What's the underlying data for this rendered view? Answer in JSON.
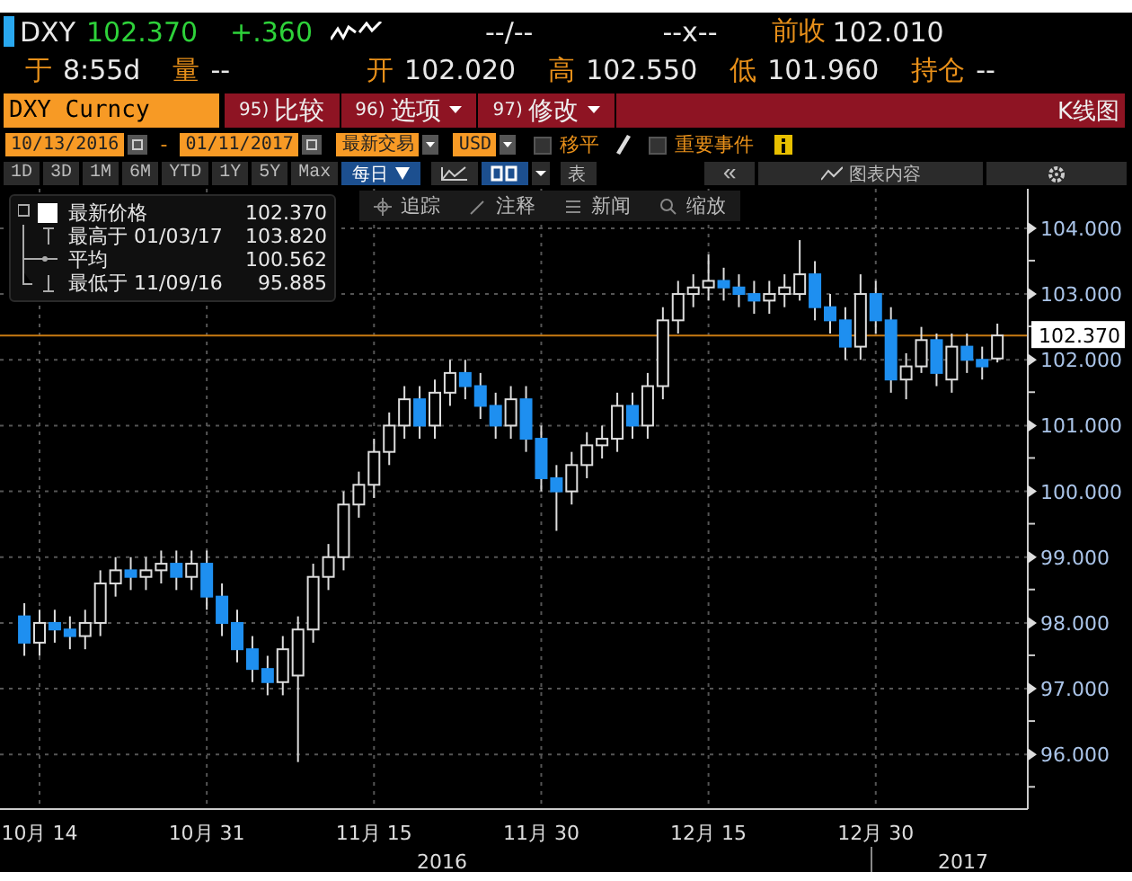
{
  "quote": {
    "ticker": "DXY",
    "price": "102.370",
    "change": "+.360",
    "bid_ask": "--/--",
    "size": "--x--",
    "prev_close_label": "前收",
    "prev_close": "102.010"
  },
  "stats": [
    {
      "label": "于",
      "value": "8:55d"
    },
    {
      "label": "量",
      "value": "--"
    },
    {
      "label": "开",
      "value": "102.020"
    },
    {
      "label": "高",
      "value": "102.550"
    },
    {
      "label": "低",
      "value": "101.960"
    },
    {
      "label": "持仓",
      "value": "--"
    }
  ],
  "security": "DXY Curncy",
  "actions": [
    {
      "number": "95)",
      "label": "比较",
      "dropdown": false
    },
    {
      "number": "96)",
      "label": "选项",
      "dropdown": true
    },
    {
      "number": "97)",
      "label": "修改",
      "dropdown": true
    }
  ],
  "view_title": "K线图",
  "date_range": {
    "start": "10/13/2016",
    "separator": "-",
    "end": "01/11/2017"
  },
  "price_field": "最新交易",
  "currency": "USD",
  "options": [
    {
      "label": "移平",
      "checked": false
    },
    {
      "label": "重要事件",
      "checked": false
    }
  ],
  "periods": [
    {
      "label": "1D",
      "selected": false
    },
    {
      "label": "3D",
      "selected": false
    },
    {
      "label": "1M",
      "selected": false
    },
    {
      "label": "6M",
      "selected": false
    },
    {
      "label": "YTD",
      "selected": false
    },
    {
      "label": "1Y",
      "selected": false
    },
    {
      "label": "5Y",
      "selected": false
    },
    {
      "label": "Max",
      "selected": false
    }
  ],
  "frequency": "每日",
  "table_button": "表",
  "collapse_button": "«",
  "chart_contents": "图表内容",
  "tools": [
    "追踪",
    "注释",
    "新闻",
    "缩放"
  ],
  "legend": [
    {
      "kind": "last",
      "label": "最新价格",
      "value": "102.370"
    },
    {
      "kind": "high",
      "label": "最高于 01/03/17",
      "value": "103.820"
    },
    {
      "kind": "average",
      "label": "平均",
      "value": "100.562"
    },
    {
      "kind": "low",
      "label": "最低于 11/09/16",
      "value": "95.885"
    }
  ],
  "chart": {
    "price_tag": "102.370",
    "years": [
      "2016",
      "2017"
    ],
    "chart_data": {
      "type": "candlestick",
      "categories": [
        null,
        "10月 14",
        null,
        null,
        null,
        null,
        null,
        null,
        null,
        null,
        null,
        null,
        "10月 31",
        null,
        null,
        null,
        null,
        null,
        null,
        null,
        null,
        null,
        null,
        "11月 15",
        null,
        null,
        null,
        null,
        null,
        null,
        null,
        null,
        null,
        null,
        "11月 30",
        null,
        null,
        null,
        null,
        null,
        null,
        null,
        null,
        null,
        null,
        "12月 15",
        null,
        null,
        null,
        null,
        null,
        null,
        null,
        null,
        null,
        null,
        "12月 30",
        null,
        null,
        null,
        null,
        null,
        null,
        null,
        null
      ],
      "ohlc": [
        [
          98.1,
          98.3,
          97.5,
          97.7
        ],
        [
          97.7,
          98.2,
          97.5,
          98.0
        ],
        [
          98.0,
          98.2,
          97.7,
          97.9
        ],
        [
          97.9,
          98.1,
          97.6,
          97.8
        ],
        [
          97.8,
          98.2,
          97.6,
          98.0
        ],
        [
          98.0,
          98.8,
          97.8,
          98.6
        ],
        [
          98.6,
          99.0,
          98.4,
          98.8
        ],
        [
          98.8,
          99.0,
          98.5,
          98.7
        ],
        [
          98.7,
          99.0,
          98.5,
          98.8
        ],
        [
          98.8,
          99.1,
          98.6,
          98.9
        ],
        [
          98.9,
          99.1,
          98.5,
          98.7
        ],
        [
          98.7,
          99.1,
          98.5,
          98.9
        ],
        [
          98.9,
          99.1,
          98.2,
          98.4
        ],
        [
          98.4,
          98.6,
          97.8,
          98.0
        ],
        [
          98.0,
          98.2,
          97.4,
          97.6
        ],
        [
          97.6,
          97.8,
          97.1,
          97.3
        ],
        [
          97.3,
          97.5,
          96.9,
          97.1
        ],
        [
          97.1,
          97.8,
          96.9,
          97.6
        ],
        [
          97.2,
          98.1,
          95.885,
          97.9
        ],
        [
          97.9,
          98.9,
          97.7,
          98.7
        ],
        [
          98.7,
          99.2,
          98.5,
          99.0
        ],
        [
          99.0,
          100.0,
          98.8,
          99.8
        ],
        [
          99.8,
          100.3,
          99.6,
          100.1
        ],
        [
          100.1,
          100.8,
          99.9,
          100.6
        ],
        [
          100.6,
          101.2,
          100.4,
          101.0
        ],
        [
          101.0,
          101.6,
          100.8,
          101.4
        ],
        [
          101.4,
          101.6,
          100.8,
          101.0
        ],
        [
          101.0,
          101.7,
          100.8,
          101.5
        ],
        [
          101.5,
          102.0,
          101.3,
          101.8
        ],
        [
          101.8,
          102.0,
          101.4,
          101.6
        ],
        [
          101.6,
          101.8,
          101.1,
          101.3
        ],
        [
          101.3,
          101.5,
          100.8,
          101.0
        ],
        [
          101.0,
          101.6,
          100.8,
          101.4
        ],
        [
          101.4,
          101.6,
          100.6,
          100.8
        ],
        [
          100.8,
          101.0,
          100.0,
          100.2
        ],
        [
          100.2,
          100.4,
          99.4,
          100.0
        ],
        [
          100.0,
          100.6,
          99.8,
          100.4
        ],
        [
          100.4,
          100.9,
          100.2,
          100.7
        ],
        [
          100.7,
          101.0,
          100.5,
          100.8
        ],
        [
          100.8,
          101.5,
          100.6,
          101.3
        ],
        [
          101.3,
          101.5,
          100.8,
          101.0
        ],
        [
          101.0,
          101.8,
          100.8,
          101.6
        ],
        [
          101.6,
          102.8,
          101.4,
          102.6
        ],
        [
          102.6,
          103.2,
          102.4,
          103.0
        ],
        [
          103.0,
          103.3,
          102.8,
          103.1
        ],
        [
          103.1,
          103.6,
          102.9,
          103.2
        ],
        [
          103.2,
          103.4,
          102.9,
          103.1
        ],
        [
          103.1,
          103.3,
          102.8,
          103.0
        ],
        [
          103.0,
          103.2,
          102.7,
          102.9
        ],
        [
          102.9,
          103.2,
          102.7,
          103.0
        ],
        [
          103.0,
          103.3,
          102.8,
          103.1
        ],
        [
          103.0,
          103.82,
          102.9,
          103.3
        ],
        [
          103.3,
          103.5,
          102.6,
          102.8
        ],
        [
          102.8,
          103.0,
          102.4,
          102.6
        ],
        [
          102.6,
          102.8,
          102.0,
          102.2
        ],
        [
          102.2,
          103.3,
          102.0,
          103.0
        ],
        [
          103.0,
          103.2,
          102.4,
          102.6
        ],
        [
          102.6,
          102.8,
          101.5,
          101.7
        ],
        [
          101.7,
          102.1,
          101.4,
          101.9
        ],
        [
          101.9,
          102.5,
          101.8,
          102.3
        ],
        [
          102.3,
          102.4,
          101.6,
          101.8
        ],
        [
          101.7,
          102.4,
          101.5,
          102.2
        ],
        [
          102.2,
          102.4,
          101.8,
          102.0
        ],
        [
          102.0,
          102.2,
          101.7,
          101.9
        ],
        [
          102.02,
          102.55,
          101.96,
          102.37
        ]
      ],
      "ylim": [
        95.17,
        104.6
      ],
      "grid": true,
      "ref_lines": [
        {
          "axis": "y",
          "value": 102.37,
          "color": "#c77a12"
        }
      ],
      "yticks": [
        {
          "value": 104,
          "label": "104.000"
        },
        {
          "value": 103,
          "label": "103.000"
        },
        {
          "value": 102,
          "label": "102.000"
        },
        {
          "value": 101,
          "label": "101.000"
        },
        {
          "value": 100,
          "label": "100.000"
        },
        {
          "value": 99,
          "label": "99.000"
        },
        {
          "value": 98,
          "label": "98.000"
        },
        {
          "value": 97,
          "label": "97.000"
        },
        {
          "value": 96,
          "label": "96.000"
        }
      ]
    }
  }
}
